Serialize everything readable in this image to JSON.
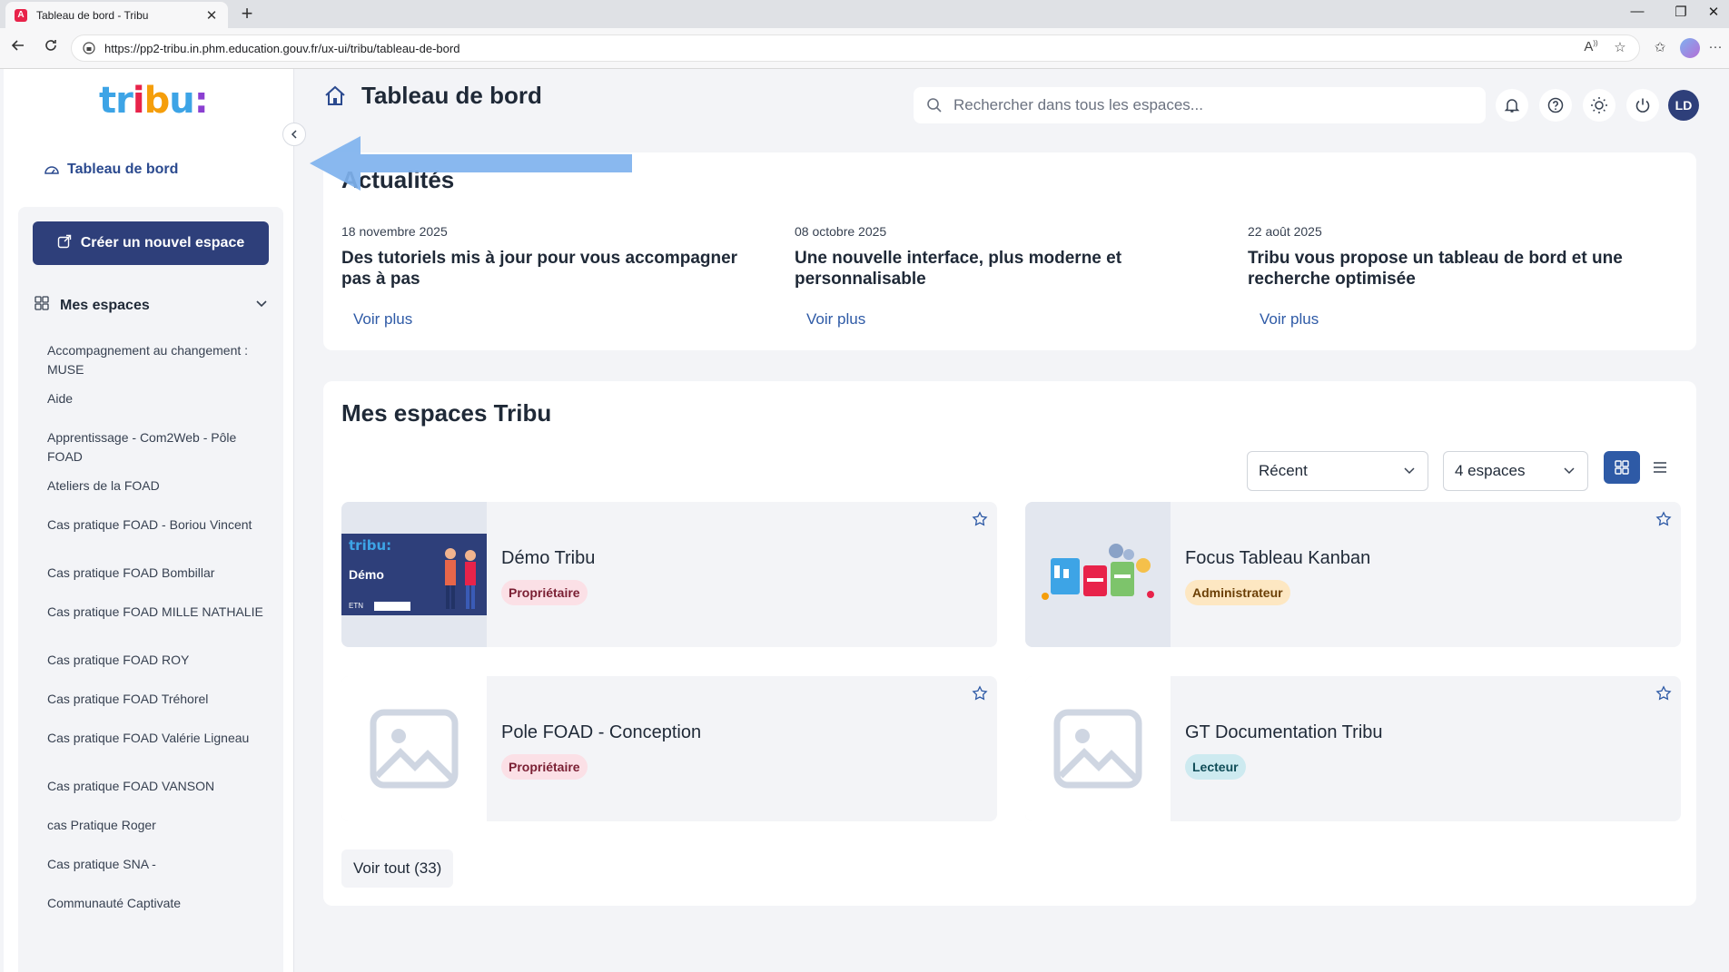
{
  "browser": {
    "tab_title": "Tableau de bord - Tribu",
    "favicon_letter": "A",
    "url": "https://pp2-tribu.in.phm.education.gouv.fr/ux-ui/tribu/tableau-de-bord",
    "icons": [
      "back-icon",
      "reload-icon",
      "lock-icon",
      "read-aloud-icon",
      "favorite-star-icon",
      "favorites-icon",
      "profile-icon",
      "more-icon",
      "minimize-icon",
      "maximize-icon",
      "close-icon"
    ]
  },
  "sidebar": {
    "logo": [
      "tr",
      "i",
      "b",
      "u",
      ":"
    ],
    "dashboard_label": "Tableau de bord",
    "create_button": "Créer un nouvel espace",
    "my_spaces_label": "Mes espaces",
    "spaces": [
      "Accompagnement au changement : MUSE",
      "Aide",
      "Apprentissage - Com2Web - Pôle FOAD",
      "Ateliers de la FOAD",
      "Cas pratique FOAD - Boriou Vincent",
      "Cas pratique FOAD Bombillar",
      "Cas pratique FOAD MILLE NATHALIE",
      "Cas pratique FOAD ROY",
      "Cas pratique FOAD Tréhorel",
      "Cas pratique FOAD Valérie Ligneau",
      "Cas pratique FOAD VANSON",
      "cas Pratique Roger",
      "Cas pratique SNA -",
      "Communauté Captivate"
    ]
  },
  "header": {
    "title": "Tableau de bord",
    "search_placeholder": "Rechercher dans tous les espaces...",
    "avatar_initials": "LD"
  },
  "news": {
    "title": "Actualités",
    "items": [
      {
        "date": "18 novembre 2025",
        "title": "Des tutoriels mis à jour pour vous accompagner pas à pas",
        "more": "Voir plus"
      },
      {
        "date": "08 octobre 2025",
        "title": "Une nouvelle interface, plus moderne et personnalisable",
        "more": "Voir plus"
      },
      {
        "date": "22 août 2025",
        "title": "Tribu vous propose un tableau de bord et une recherche optimisée",
        "more": "Voir plus"
      }
    ]
  },
  "spaces_section": {
    "title": "Mes espaces Tribu",
    "sort_value": "Récent",
    "count_value": "4 espaces",
    "cards": [
      {
        "name": "Démo Tribu",
        "role": "Propriétaire",
        "thumb_text": "Démo",
        "thumb_logo": "tribu:",
        "thumb_footer": "ETN"
      },
      {
        "name": "Focus Tableau Kanban",
        "role": "Administrateur"
      },
      {
        "name": "Pole FOAD - Conception",
        "role": "Propriétaire"
      },
      {
        "name": "GT Documentation Tribu",
        "role": "Lecteur"
      }
    ],
    "see_all": "Voir tout (33)"
  },
  "colors": {
    "primary": "#2e3f7a",
    "link": "#2e5aa6",
    "background": "#f3f4f7",
    "annotation_arrow": "#7fb2ee"
  }
}
